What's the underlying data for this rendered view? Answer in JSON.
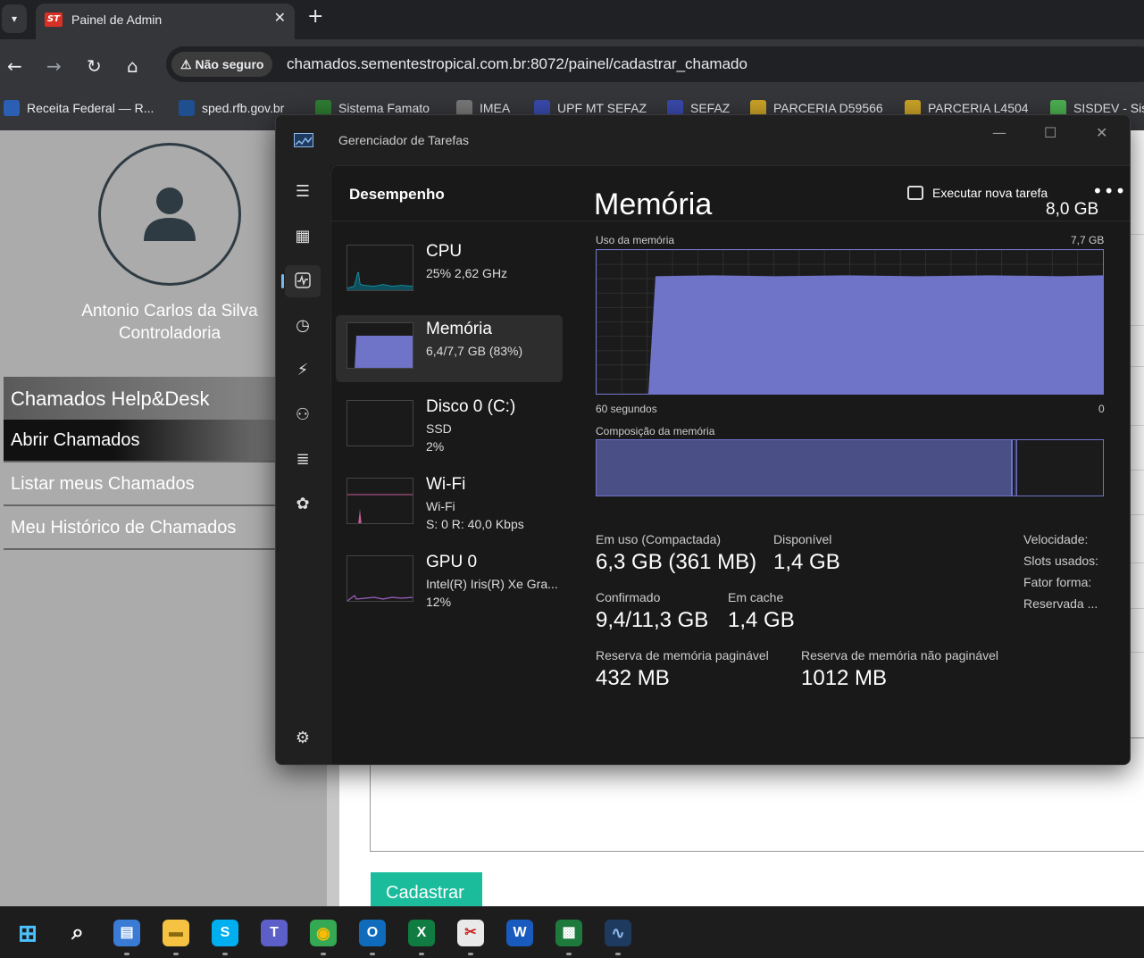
{
  "browser": {
    "tab": {
      "title": "Painel de Admin",
      "favicon_text": "ST"
    },
    "address": {
      "security_label": "Não seguro",
      "url": "chamados.sementestropical.com.br:8072/painel/cadastrar_chamado"
    },
    "bookmarks": [
      {
        "label": "Receita Federal — R...",
        "color": "#2b5fb3"
      },
      {
        "label": "sped.rfb.gov.br",
        "color": "#1f4f8f"
      },
      {
        "label": "Sistema Famato",
        "color": "#2e7d32"
      },
      {
        "label": "IMEA",
        "color": "#777777"
      },
      {
        "label": "UPF MT SEFAZ",
        "color": "#3949ab"
      },
      {
        "label": "SEFAZ",
        "color": "#3949ab"
      },
      {
        "label": "PARCERIA D59566",
        "color": "#c9a227"
      },
      {
        "label": "PARCERIA L4504",
        "color": "#c9a227"
      },
      {
        "label": "SISDEV - Sis",
        "color": "#4caf50"
      }
    ]
  },
  "webpage": {
    "user_name": "Antonio Carlos da Silva",
    "user_role": "Controladoria",
    "menu_header": "Chamados Help&Desk",
    "menu_items": [
      "Abrir Chamados",
      "Listar meus Chamados",
      "Meu Histórico de Chamados"
    ],
    "submit_label": "Cadastrar"
  },
  "taskmanager": {
    "window_title": "Gerenciador de Tarefas",
    "section_title": "Desempenho",
    "run_task_label": "Executar nova tarefa",
    "more_label": "•••",
    "items": [
      {
        "name": "CPU",
        "sub1": "25%  2,62 GHz",
        "sub2": "",
        "sub3": ""
      },
      {
        "name": "Memória",
        "sub1": "6,4/7,7 GB (83%)",
        "sub2": "",
        "sub3": ""
      },
      {
        "name": "Disco 0 (C:)",
        "sub1": "SSD",
        "sub2": "2%",
        "sub3": ""
      },
      {
        "name": "Wi-Fi",
        "sub1": "Wi-Fi",
        "sub2": "S: 0  R: 40,0 Kbps",
        "sub3": ""
      },
      {
        "name": "GPU 0",
        "sub1": "Intel(R) Iris(R) Xe Gra...",
        "sub2": "12%",
        "sub3": ""
      }
    ],
    "detail": {
      "title": "Memória",
      "total": "8,0 GB",
      "usage_label": "Uso da memória",
      "usage_max": "7,7 GB",
      "time_left": "60 segundos",
      "time_right": "0",
      "composition_label": "Composição da memória",
      "usage_level_fraction": 0.83,
      "stats": {
        "in_use_label": "Em uso (Compactada)",
        "in_use_value": "6,3 GB (361 MB)",
        "available_label": "Disponível",
        "available_value": "1,4 GB",
        "committed_label": "Confirmado",
        "committed_value": "9,4/11,3 GB",
        "cached_label": "Em cache",
        "cached_value": "1,4 GB",
        "paged_label": "Reserva de memória paginável",
        "paged_value": "432 MB",
        "nonpaged_label": "Reserva de memória não paginável",
        "nonpaged_value": "1012 MB",
        "speed_label": "Velocidade:",
        "slots_label": "Slots usados:",
        "form_label": "Fator forma:",
        "reserved_label": "Reservada ..."
      }
    }
  },
  "taskbar": {
    "apps": [
      "start",
      "search",
      "widgets",
      "file-explorer",
      "skype",
      "teams",
      "chrome",
      "outlook",
      "excel",
      "snipping-tool",
      "word",
      "network-app",
      "task-manager"
    ]
  }
}
